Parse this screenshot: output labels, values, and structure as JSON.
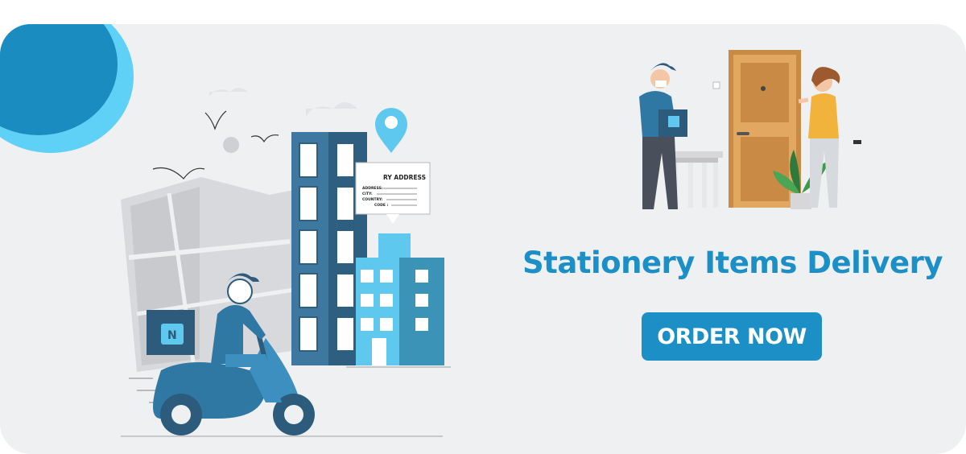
{
  "hero": {
    "address_card": {
      "heading": "RY ADDRESS",
      "fields": [
        "ADDRESS:",
        "CITY:",
        "COUNTRY:",
        "CODE :"
      ]
    },
    "box_logo": "N"
  },
  "headline": "Stationery Items Delivery",
  "cta_label": "ORDER NOW",
  "colors": {
    "brand_blue": "#1b8fc6",
    "light_cyan": "#5fd1f7",
    "background": "#eff0f2"
  }
}
